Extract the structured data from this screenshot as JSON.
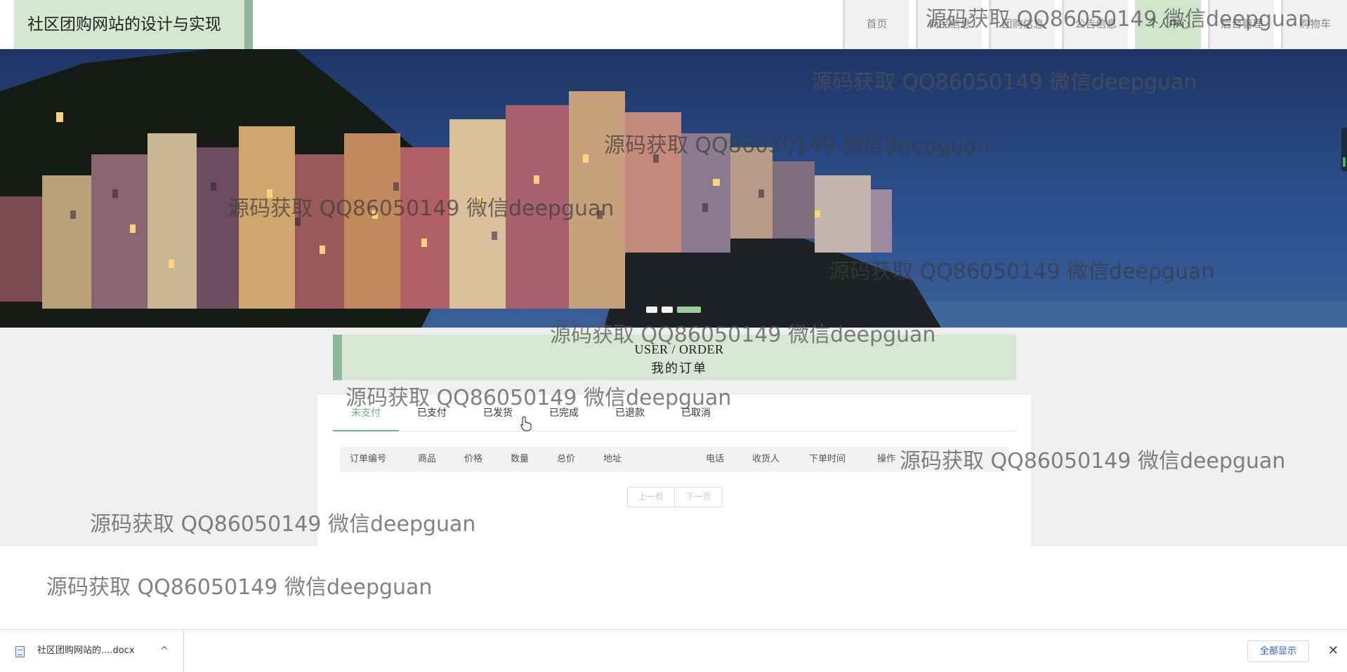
{
  "header": {
    "site_title": "社区团购网站的设计与实现",
    "nav": [
      {
        "label": "首页",
        "active": false
      },
      {
        "label": "商品信息",
        "active": false
      },
      {
        "label": "团购信息",
        "active": false
      },
      {
        "label": "公告信息",
        "active": false
      },
      {
        "label": "个人中心",
        "active": true
      },
      {
        "label": "后台管理",
        "active": false
      },
      {
        "label": "购物车",
        "active": false
      }
    ]
  },
  "banner": {
    "slides": 3,
    "active_slide": 3
  },
  "order_section": {
    "title_en": "USER / ORDER",
    "title_cn": "我的订单",
    "tabs": [
      {
        "label": "未支付",
        "active": true
      },
      {
        "label": "已支付",
        "active": false
      },
      {
        "label": "已发货",
        "active": false
      },
      {
        "label": "已完成",
        "active": false
      },
      {
        "label": "已退款",
        "active": false
      },
      {
        "label": "已取消",
        "active": false
      }
    ],
    "columns": [
      "订单编号",
      "商品",
      "价格",
      "数量",
      "总价",
      "地址",
      "电话",
      "收货人",
      "下单时间",
      "操作"
    ],
    "rows": [],
    "pager": {
      "prev": "上一页",
      "next": "下一页"
    }
  },
  "watermark": "源码获取 QQ86050149 微信deepguan",
  "download_bar": {
    "file_name": "社区团购网站的....docx",
    "show_all": "全部显示",
    "close": "✕",
    "chevron": "^"
  },
  "colors": {
    "accent_green": "#8fb79a",
    "light_green": "#d6e8d4",
    "active_tab": "#6bb17a",
    "link_blue": "#1a5fd6"
  }
}
